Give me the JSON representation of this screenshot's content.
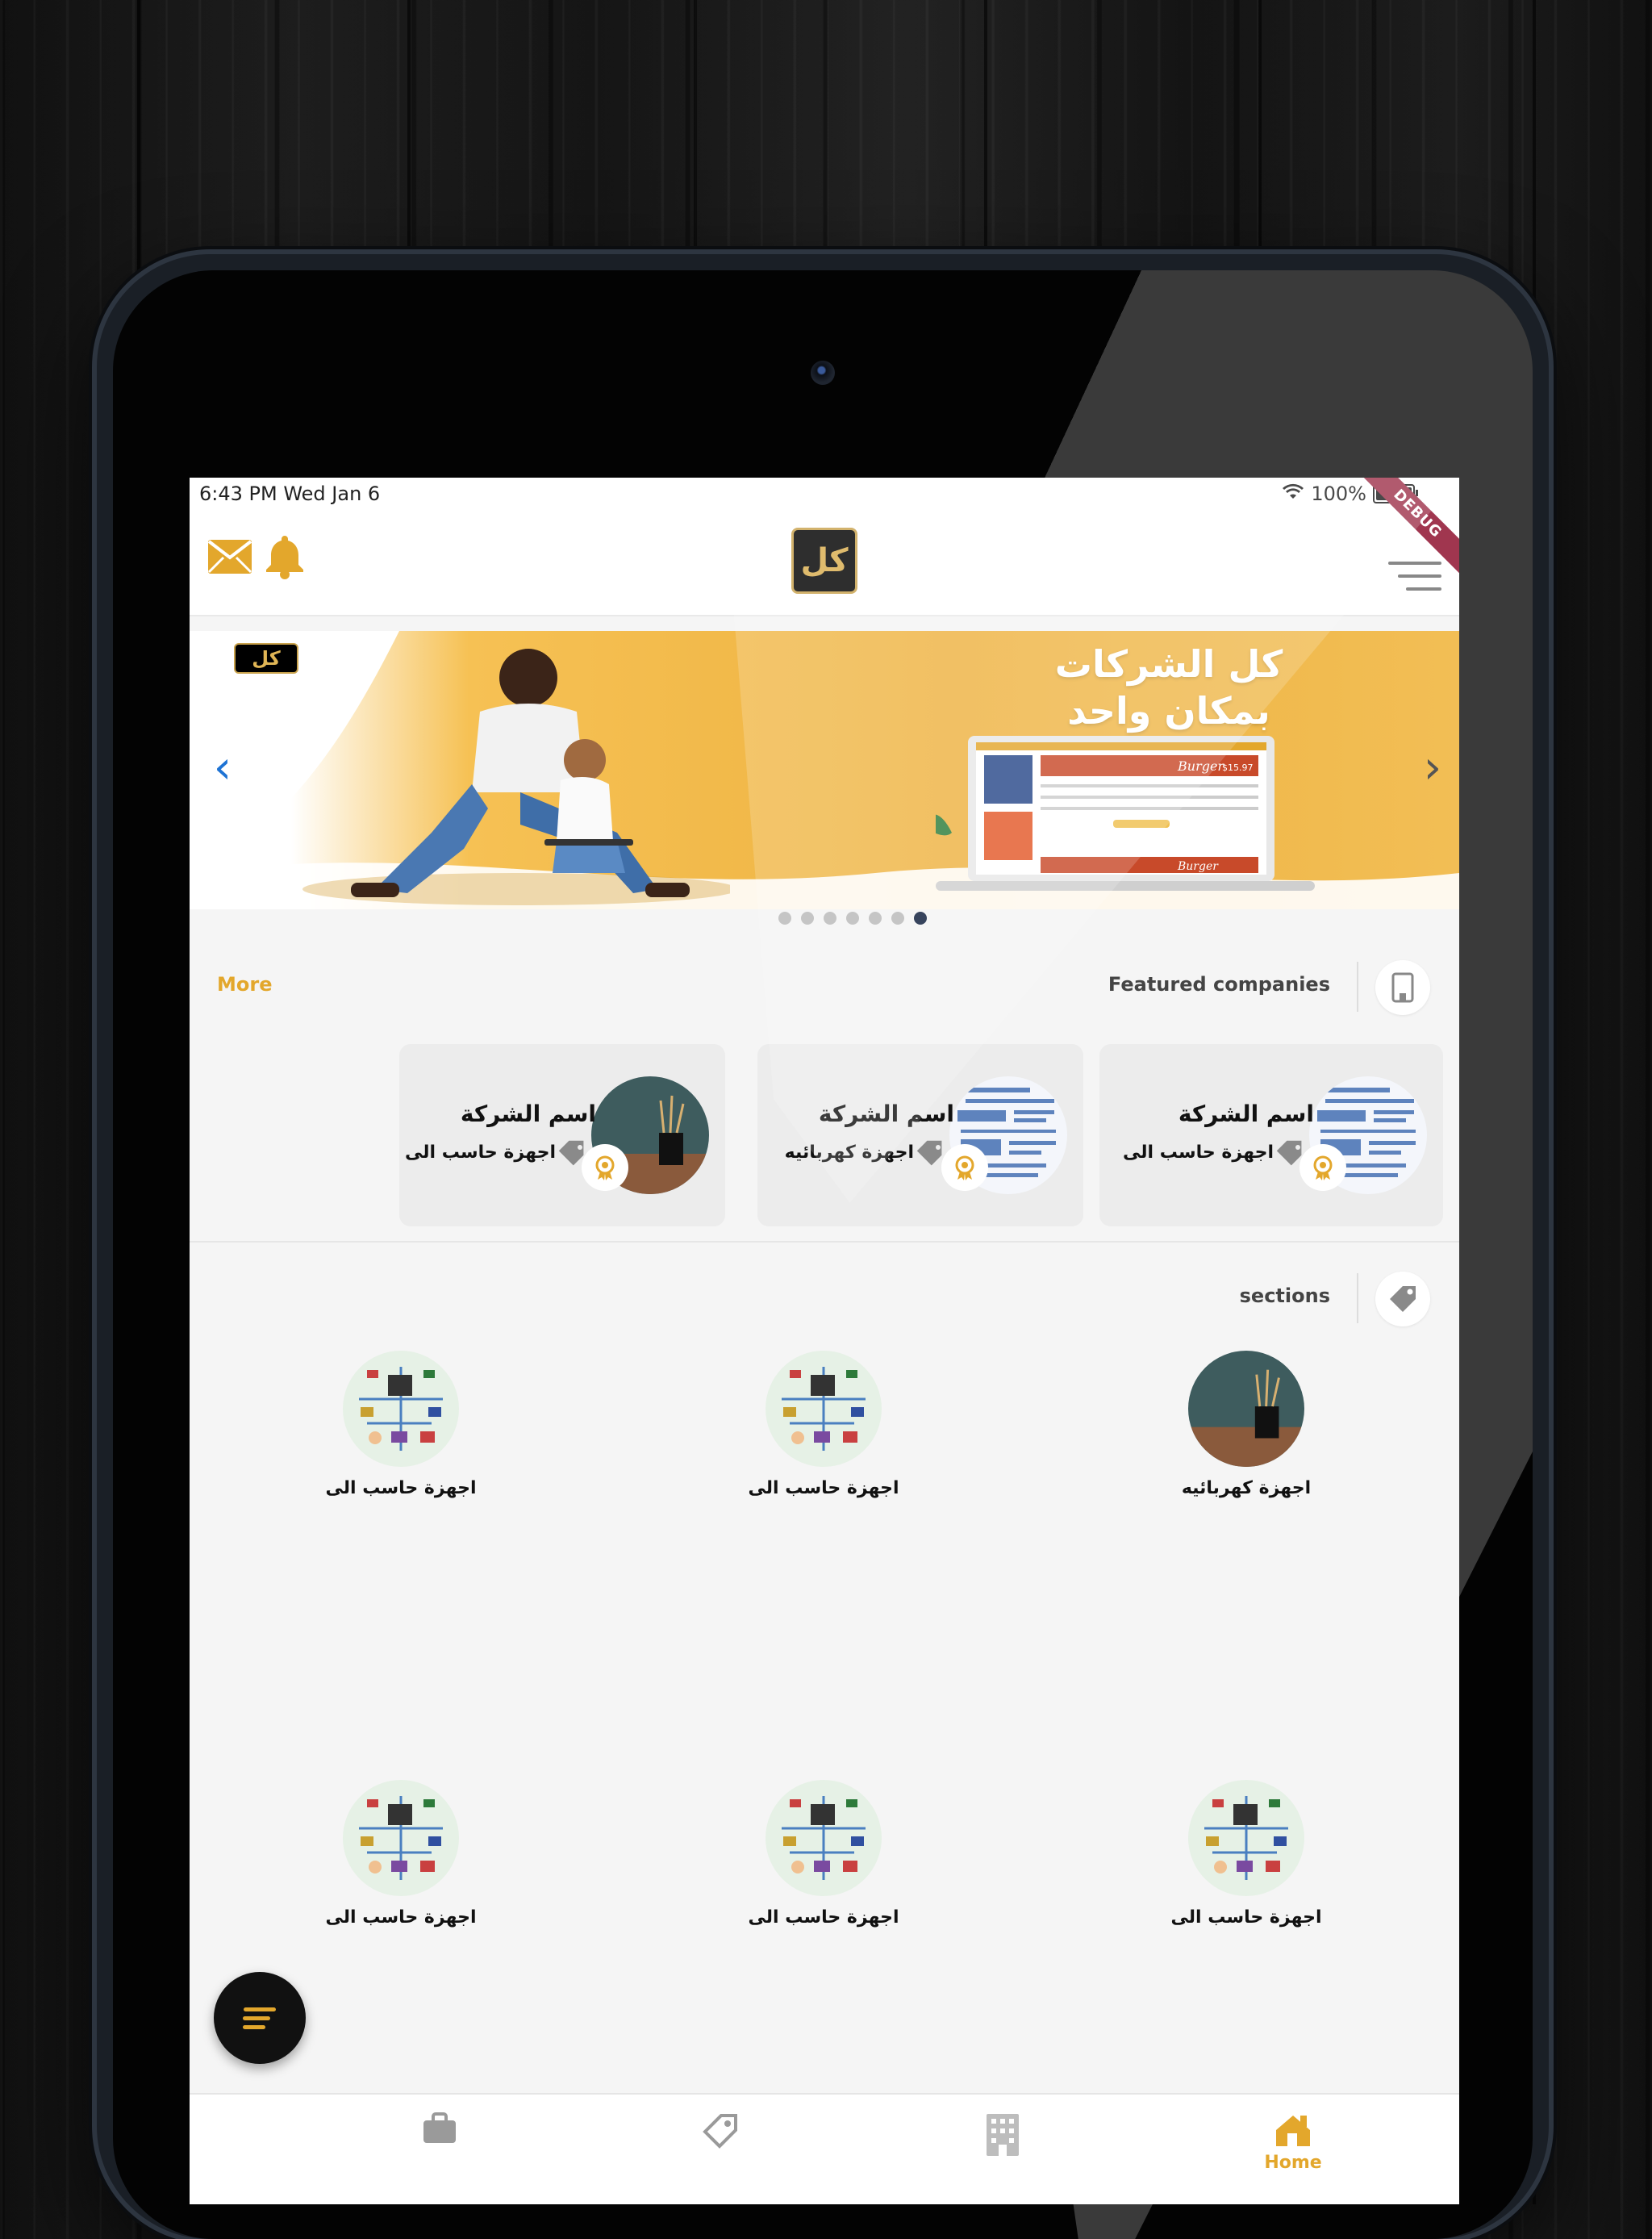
{
  "status_bar": {
    "time": "6:43 PM   Wed Jan 6",
    "battery": "100%"
  },
  "debug_ribbon": "DEBUG",
  "app_bar": {
    "logo_text": "كل",
    "icons": [
      "mail-icon",
      "bell-icon",
      "menu-icon"
    ]
  },
  "banner": {
    "logo_text": "كل",
    "title_line1": "كل الشركات",
    "title_line2": "بمكان واحد",
    "laptop_label": "Burger",
    "laptop_price": "$15.97",
    "slides_count": 7,
    "active_slide": 7
  },
  "featured": {
    "title": "Featured companies",
    "more_label": "More",
    "cards": [
      {
        "name": "اسم الشركة",
        "category": "اجهزة حاسب الى"
      },
      {
        "name": "اسم الشركة",
        "category": "اجهزة كهربائيه"
      },
      {
        "name": "اسم الشركة",
        "category": "اجهزة حاسب الى"
      }
    ]
  },
  "sections": {
    "title": "sections",
    "items": [
      {
        "label": "اجهزة كهربائيه"
      },
      {
        "label": "اجهزة حاسب الى"
      },
      {
        "label": "اجهزة حاسب الى"
      },
      {
        "label": "اجهزة حاسب الى"
      },
      {
        "label": "اجهزة حاسب الى"
      },
      {
        "label": "اجهزة حاسب الى"
      }
    ]
  },
  "bottom_nav": {
    "tabs": [
      {
        "icon": "home-icon",
        "label": "Home",
        "active": true
      },
      {
        "icon": "building-icon",
        "label": ""
      },
      {
        "icon": "tag-icon",
        "label": ""
      },
      {
        "icon": "briefcase-icon",
        "label": ""
      }
    ]
  },
  "colors": {
    "accent": "#e3a72c",
    "banner": "#f0b848",
    "arrow": "#1e73d4",
    "dark": "#111111"
  }
}
